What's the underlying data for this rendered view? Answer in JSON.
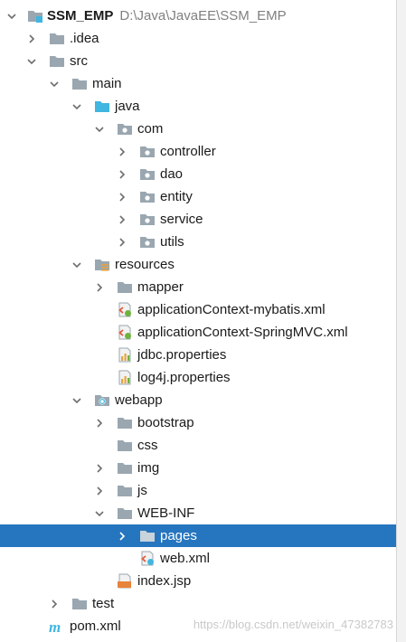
{
  "tree": {
    "root": {
      "name": "SSM_EMP",
      "path": "D:\\Java\\JavaEE\\SSM_EMP"
    },
    "idea": ".idea",
    "src": "src",
    "main": "main",
    "java": "java",
    "com": "com",
    "controller": "controller",
    "dao": "dao",
    "entity": "entity",
    "service": "service",
    "utils": "utils",
    "resources": "resources",
    "mapper": "mapper",
    "appctx_mybatis": "applicationContext-mybatis.xml",
    "appctx_springmvc": "applicationContext-SpringMVC.xml",
    "jdbc_props": "jdbc.properties",
    "log4j_props": "log4j.properties",
    "webapp": "webapp",
    "bootstrap": "bootstrap",
    "css": "css",
    "img": "img",
    "js": "js",
    "webinf": "WEB-INF",
    "pages": "pages",
    "webxml": "web.xml",
    "indexjsp": "index.jsp",
    "test": "test",
    "pom": "pom.xml"
  },
  "selected_item": "pages",
  "watermark": "https://blog.csdn.net/weixin_47382783",
  "icons": {
    "folder": "folder-icon",
    "module": "module-folder-icon",
    "source_root": "source-root-folder-icon",
    "package": "package-icon",
    "resources_root": "resources-root-icon",
    "web_root": "web-root-folder-icon",
    "xml": "xml-file-icon",
    "properties": "properties-file-icon",
    "jsp": "jsp-file-icon",
    "maven": "maven-file-icon"
  },
  "colors": {
    "selection": "#2675bf",
    "folder": "#9aa7b0",
    "source_folder": "#40b6e0",
    "path_text": "#808080"
  }
}
